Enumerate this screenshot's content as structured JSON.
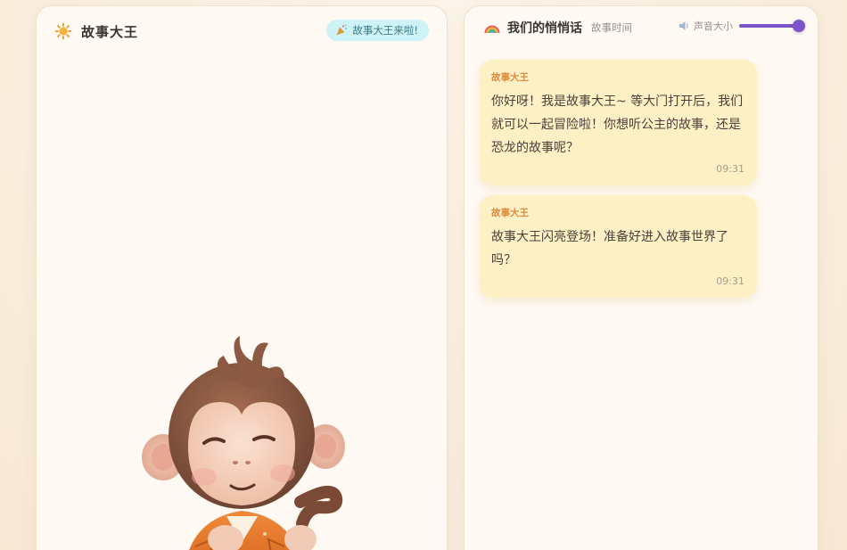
{
  "story_panel": {
    "title": "故事大王",
    "badge_text": "故事大王来啦!"
  },
  "chat_panel": {
    "title": "我们的悄悄话",
    "subtitle": "故事时间",
    "volume_label": "声音大小",
    "volume_level": 1.0,
    "messages": [
      {
        "sender": "故事大王",
        "text": "你好呀！我是故事大王~ 等大门打开后，我们就可以一起冒险啦！你想听公主的故事，还是恐龙的故事呢？",
        "time": "09:31"
      },
      {
        "sender": "故事大王",
        "text": "故事大王闪亮登场！准备好进入故事世界了吗？",
        "time": "09:31"
      }
    ]
  },
  "colors": {
    "accent_purple": "#7b54c9",
    "bubble_bg": "#fdf0c4",
    "sender_orange": "#e18a3c",
    "badge_bg": "#cdf3f6"
  },
  "icons": {
    "header_left": "sun-icon",
    "badge": "party-popper-icon",
    "header_right": "rainbow-icon",
    "volume": "speaker-icon"
  }
}
